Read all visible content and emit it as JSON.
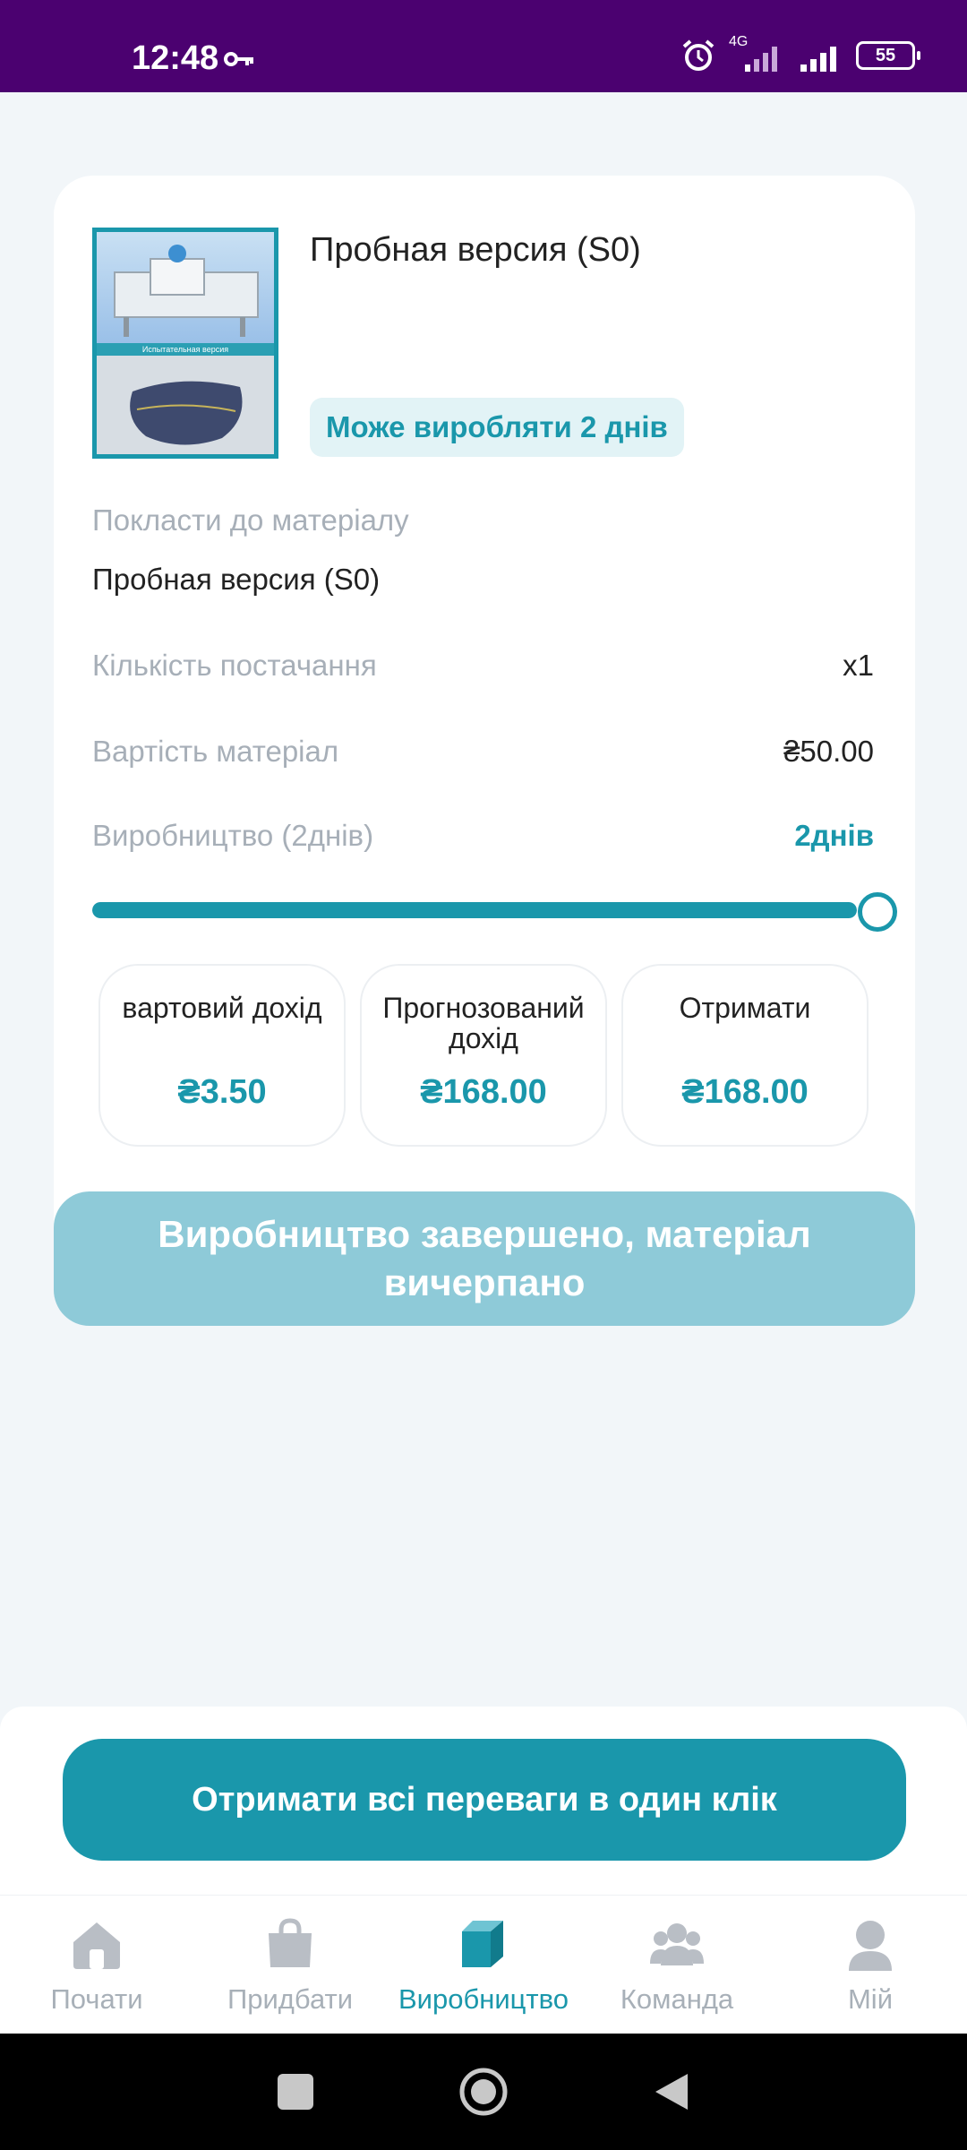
{
  "status_bar": {
    "time": "12:48",
    "network": "4G",
    "battery": "55"
  },
  "product": {
    "title": "Пробная версия (S0)",
    "image_caption": "Испытательная версия",
    "badge": "Може виробляти 2 днів"
  },
  "details": {
    "material_label": "Покласти до матеріалу",
    "material_value": "Пробная версия (S0)",
    "quantity_label": "Кількість постачання",
    "quantity_value": "x1",
    "cost_label": "Вартість матеріал",
    "cost_value": "₴50.00",
    "production_label": "Виробництво (2днів)",
    "production_value": "2днів",
    "progress": 1.0
  },
  "stats": [
    {
      "label": "вартовий дохід",
      "value": "₴3.50"
    },
    {
      "label": "Прогнозований дохід",
      "value": "₴168.00"
    },
    {
      "label": "Отримати",
      "value": "₴168.00"
    }
  ],
  "done_button": "Виробництво завершено, матеріал вичерпано",
  "claim_all_button": "Отримати всі переваги в один клік",
  "nav": [
    {
      "label": "Почати",
      "icon": "home-icon"
    },
    {
      "label": "Придбати",
      "icon": "shopping-bag-icon"
    },
    {
      "label": "Виробництво",
      "icon": "box-icon"
    },
    {
      "label": "Команда",
      "icon": "team-icon"
    },
    {
      "label": "Мій",
      "icon": "profile-icon"
    }
  ],
  "colors": {
    "accent": "#1a97ab",
    "status_bar": "#4b0170",
    "disabled_button": "#8ecad8"
  }
}
